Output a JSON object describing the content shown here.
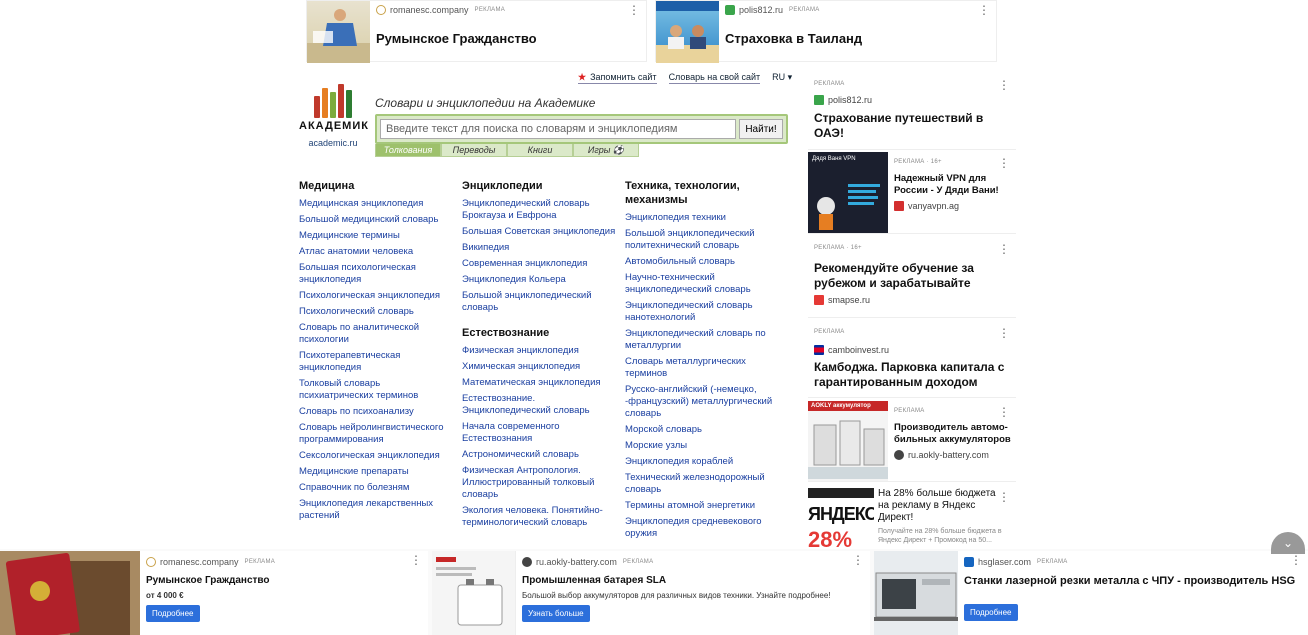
{
  "top_ads": [
    {
      "domain": "romanesc.company",
      "tag": "РЕКЛАМА",
      "title": "Румынское Гражданство"
    },
    {
      "domain": "polis812.ru",
      "tag": "РЕКЛАМА",
      "title": "Страховка в Таиланд"
    }
  ],
  "header": {
    "remember_site": "Запомнить сайт",
    "dict_on_site": "Словарь на свой сайт",
    "lang": "RU",
    "logo_name": "АКАДЕМИК",
    "logo_url": "academic.ru",
    "slogan": "Словари и энциклопедии на Академике",
    "search_placeholder": "Введите текст для поиска по словарям и энциклопедиям",
    "search_button": "Найти!",
    "tabs": [
      "Толкования",
      "Переводы",
      "Книги",
      "Игры ⚽"
    ]
  },
  "columns": [
    {
      "heading": "Медицина",
      "links": [
        "Медицинская энциклопедия",
        "Большой медицинский словарь",
        "Медицинские термины",
        "Атлас анатомии человека",
        "Большая психологическая энциклопедия",
        "Психологическая энциклопедия",
        "Психологический словарь",
        "Словарь по аналитической психологии",
        "Психотерапевтическая энциклопедия",
        "Толковый словарь психиатрических терминов",
        "Словарь по психоанализу",
        "Словарь нейролингвистического программирования",
        "Сексологическая энциклопедия",
        "Медицинские препараты",
        "Справочник по болезням",
        "Энциклопедия лекарственных растений"
      ]
    },
    {
      "heading": "Энциклопедии",
      "links": [
        "Энциклопедический словарь Брокгауза и Евфрона",
        "Большая Советская энциклопедия",
        "Википедия",
        "Современная энциклопедия",
        "Энциклопедия Кольера",
        "Большой энциклопедический словарь"
      ],
      "heading2": "Естествознание",
      "links2": [
        "Физическая энциклопедия",
        "Химическая энциклопедия",
        "Математическая энциклопедия",
        "Естествознание. Энциклопедический словарь",
        "Начала современного Естествознания",
        "Астрономический словарь",
        "Физическая Антропология. Иллюстрированный толковый словарь",
        "Экология человека. Понятийно-терминологический словарь"
      ]
    },
    {
      "heading": "Техника, технологии, механизмы",
      "links": [
        "Энциклопедия техники",
        "Большой энциклопедический политехнический словарь",
        "Автомобильный словарь",
        "Научно-технический энциклопедический словарь",
        "Энциклопедический словарь нанотехнологий",
        "Энциклопедический словарь по металлургии",
        "Словарь металлургических терминов",
        "Русско-английский (-немецко, -французский) металлургический словарь",
        "Морской словарь",
        "Морские узлы",
        "Энциклопедия кораблей",
        "Технический железнодорожный словарь",
        "Термины атомной энергетики",
        "Энциклопедия средневекового оружия"
      ]
    }
  ],
  "right_ads": [
    {
      "tag": "РЕКЛАМА",
      "domain": "polis812.ru",
      "title": "Страхование путешествий в ОАЭ!"
    },
    {
      "tag": "РЕКЛАМА · 16+",
      "title": "Надежный VPN для России - У Дяди Вани!",
      "domain": "vanyavpn.ag",
      "img_title": "Дядя Ваня VPN"
    },
    {
      "tag": "РЕКЛАМА · 16+",
      "title": "Рекомендуйте обучение за рубежом и зарабатывайте",
      "domain": "smapse.ru"
    },
    {
      "tag": "РЕКЛАМА",
      "domain": "camboinvest.ru",
      "title": "Камбоджа. Парковка капитала с гарантированным доходом"
    },
    {
      "tag": "РЕКЛАМА",
      "title": "Производитель автомо- бильных аккумуляторов",
      "domain": "ru.aokly-battery.com",
      "img_title": "AOKLY аккумулятор"
    },
    {
      "title": "На 28% больше бюджета на рекламу в Яндекс Директ!",
      "sub": "Получайте на 28% больше бюджета в Яндекс Директ + Промокод на 50...",
      "img_text": "ЯНДЕКС",
      "img_pct": "28%"
    }
  ],
  "bottom_ads": [
    {
      "domain": "romanesc.company",
      "tag": "РЕКЛАМА",
      "title": "Румынское Гражданство",
      "price": "от 4 000 €",
      "button": "Подробнее"
    },
    {
      "domain": "ru.aokly-battery.com",
      "tag": "РЕКЛАМА",
      "title": "Промышленная батарея SLA",
      "sub": "Большой выбор аккумуляторов для различных видов техники. Узнайте подробнее!",
      "button": "Узнать больше"
    },
    {
      "domain": "hsglaser.com",
      "tag": "РЕКЛАМА",
      "title": "Станки лазерной резки металла с ЧПУ - производитель HSG",
      "button": "Подробнее"
    }
  ]
}
